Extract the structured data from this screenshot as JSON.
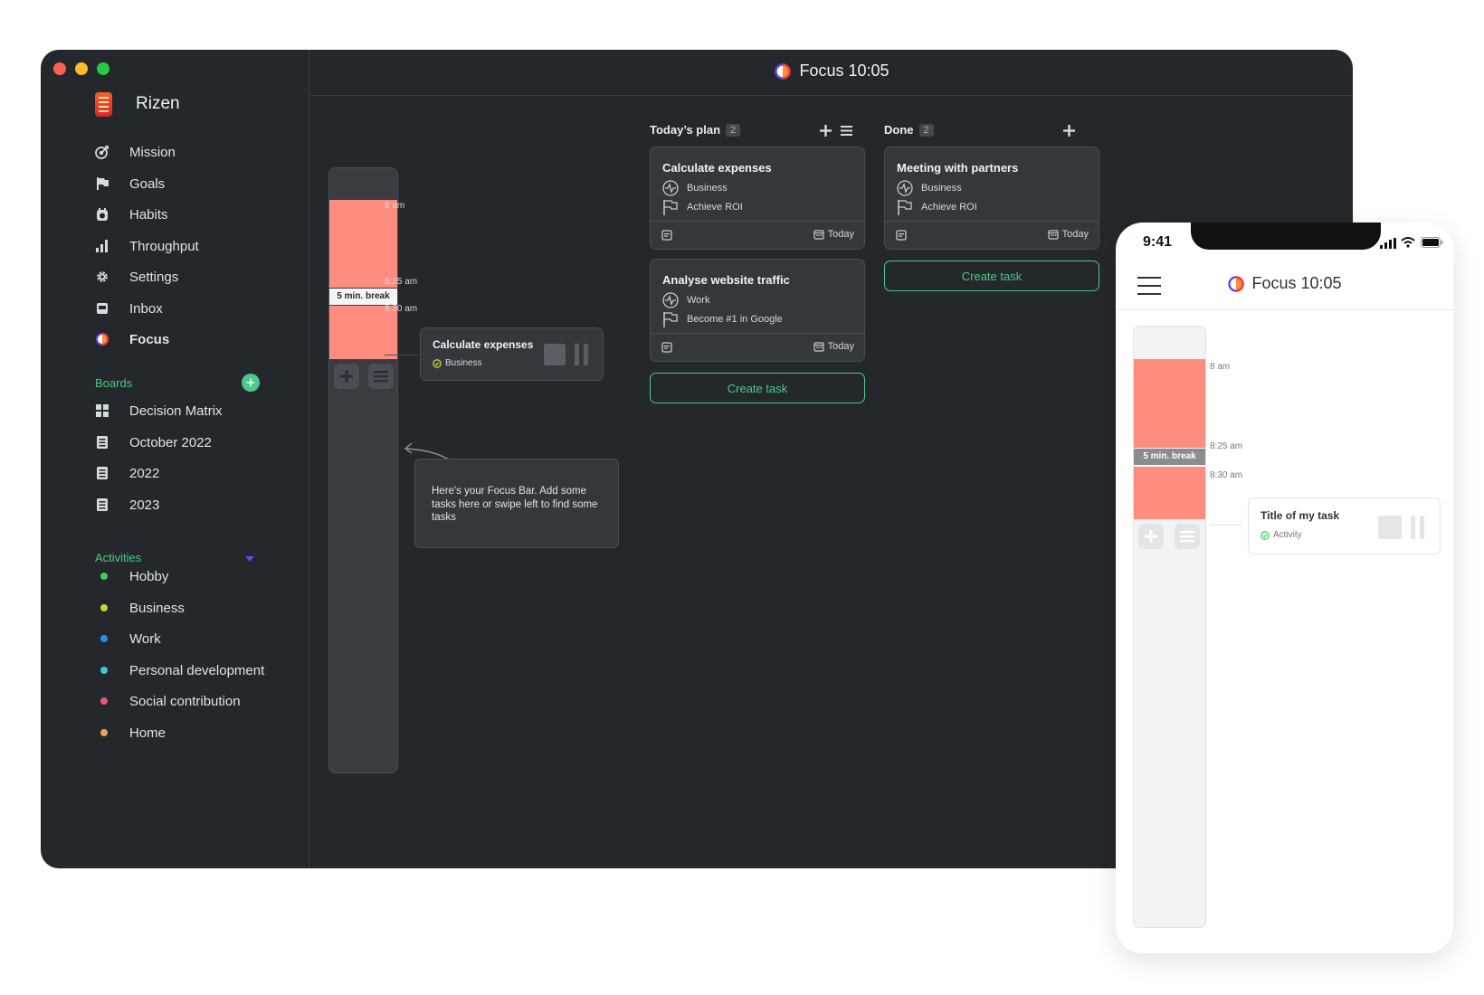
{
  "app": {
    "name": "Rizen",
    "focus_title": "Focus 10:05"
  },
  "nav": [
    {
      "label": "Mission",
      "icon": "target-icon"
    },
    {
      "label": "Goals",
      "icon": "flag-icon"
    },
    {
      "label": "Habits",
      "icon": "habit-clock-icon"
    },
    {
      "label": "Throughput",
      "icon": "bar-chart-icon"
    },
    {
      "label": "Settings",
      "icon": "gear-icon"
    },
    {
      "label": "Inbox",
      "icon": "inbox-icon"
    },
    {
      "label": "Focus",
      "icon": "focus-icon",
      "active": true
    }
  ],
  "boards": {
    "heading": "Boards",
    "items": [
      {
        "label": "Decision Matrix",
        "icon": "grid-icon"
      },
      {
        "label": "October 2022",
        "icon": "document-icon"
      },
      {
        "label": "2022",
        "icon": "document-icon"
      },
      {
        "label": "2023",
        "icon": "document-icon"
      }
    ]
  },
  "activities": {
    "heading": "Activities",
    "items": [
      {
        "label": "Hobby",
        "color": "#3ccf5a"
      },
      {
        "label": "Business",
        "color": "#c8d62b"
      },
      {
        "label": "Work",
        "color": "#2f8cf0"
      },
      {
        "label": "Personal development",
        "color": "#38c9d8"
      },
      {
        "label": "Social contribution",
        "color": "#f0557e"
      },
      {
        "label": "Home",
        "color": "#f0a25a"
      }
    ]
  },
  "focus_bar": {
    "times": [
      "8 am",
      "8:25 am",
      "8:30 am"
    ],
    "break_label": "5 min. break",
    "current_task": {
      "title": "Calculate expenses",
      "activity": "Business"
    },
    "hint": "Here's your Focus Bar. Add some tasks here or swipe left to find some tasks"
  },
  "columns": [
    {
      "title": "Today’s plan",
      "count": "2",
      "cards": [
        {
          "title": "Calculate expenses",
          "activity": "Business",
          "goal": "Achieve ROI",
          "due": "Today"
        },
        {
          "title": "Analyse website traffic",
          "activity": "Work",
          "goal": "Become #1 in Google",
          "due": "Today"
        }
      ],
      "create_label": "Create task"
    },
    {
      "title": "Done",
      "count": "2",
      "cards": [
        {
          "title": "Meeting with partners",
          "activity": "Business",
          "goal": "Achieve ROI",
          "due": "Today"
        }
      ],
      "create_label": "Create task"
    }
  ],
  "phone": {
    "time": "9:41",
    "focus_title": "Focus 10:05",
    "times": [
      "8 am",
      "8:25 am",
      "8:30 am"
    ],
    "break_label": "5 min. break",
    "task": {
      "title": "Title of my task",
      "activity": "Activity"
    }
  },
  "colors": {
    "accent": "#4cc98a",
    "focus_block": "#ff8d7f",
    "window_bg": "#24272b",
    "card_bg": "#34373c"
  }
}
